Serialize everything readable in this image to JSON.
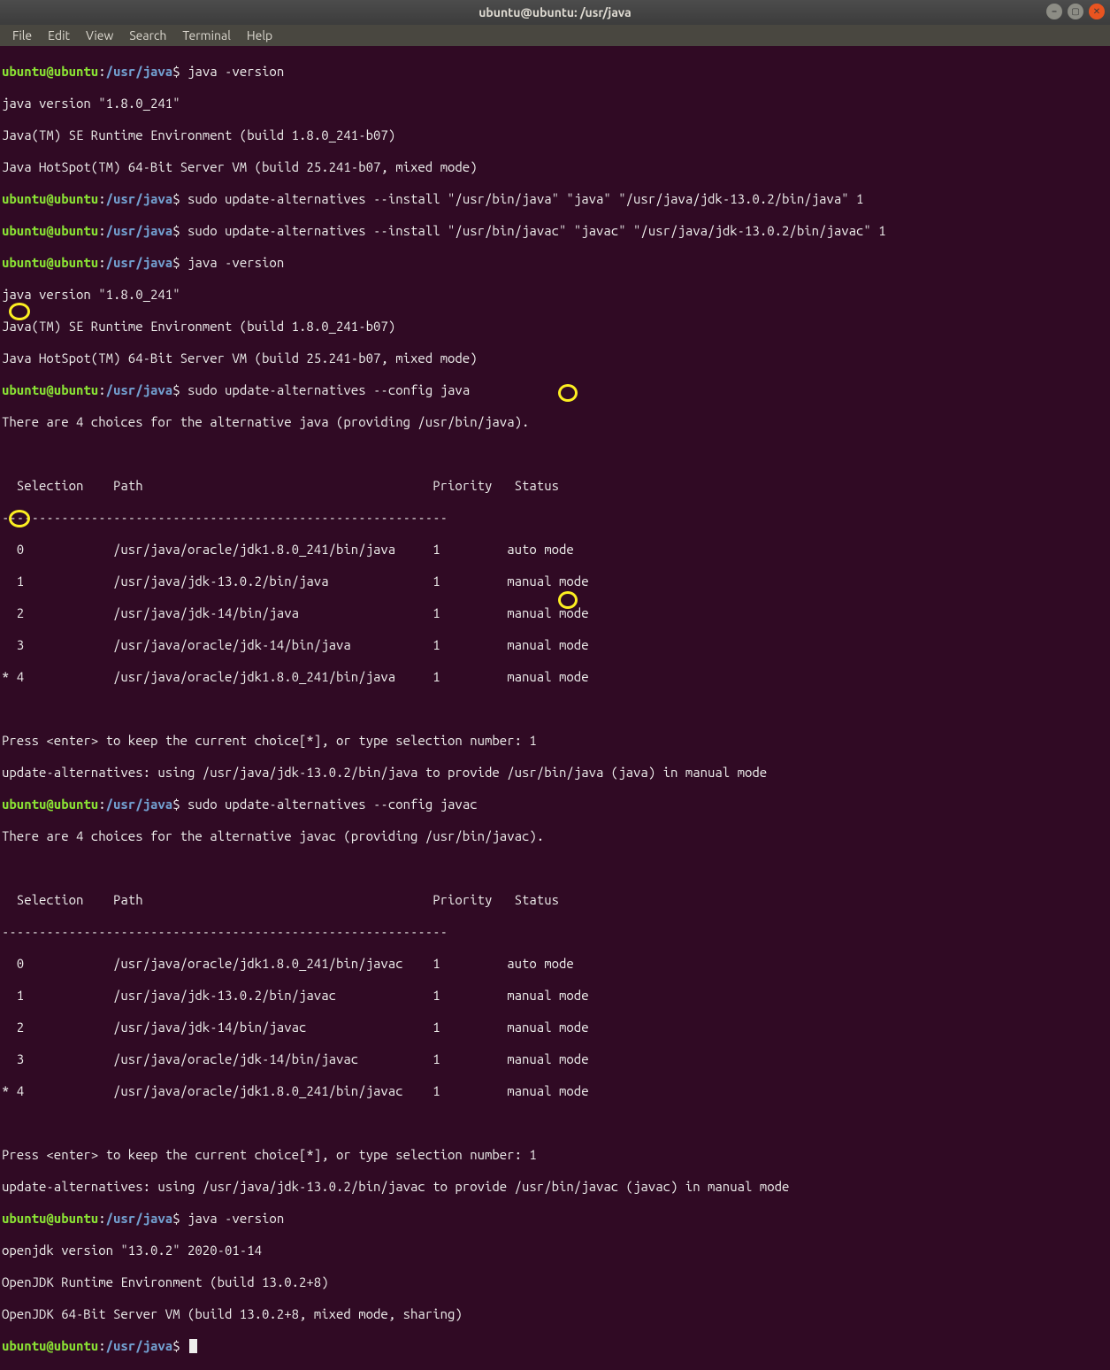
{
  "window": {
    "title": "ubuntu@ubuntu: /usr/java"
  },
  "menu": {
    "file": "File",
    "edit": "Edit",
    "view": "View",
    "search": "Search",
    "terminal": "Terminal",
    "help": "Help"
  },
  "prompt": {
    "userhost": "ubuntu@ubuntu",
    "colon": ":",
    "path": "/usr/java",
    "dollar": "$ "
  },
  "cmd": {
    "jv": "java -version",
    "inst_java": "sudo update-alternatives --install \"/usr/bin/java\" \"java\" \"/usr/java/jdk-13.0.2/bin/java\" 1",
    "inst_javac": "sudo update-alternatives --install \"/usr/bin/javac\" \"javac\" \"/usr/java/jdk-13.0.2/bin/javac\" 1",
    "cfg_java": "sudo update-alternatives --config java",
    "cfg_javac": "sudo update-alternatives --config javac"
  },
  "out": {
    "jv1_l1": "java version \"1.8.0_241\"",
    "jv1_l2": "Java(TM) SE Runtime Environment (build 1.8.0_241-b07)",
    "jv1_l3": "Java HotSpot(TM) 64-Bit Server VM (build 25.241-b07, mixed mode)",
    "choices_java": "There are 4 choices for the alternative java (providing /usr/bin/java).",
    "choices_javac": "There are 4 choices for the alternative javac (providing /usr/bin/javac).",
    "header": "  Selection    Path                                       Priority   Status",
    "rule": "------------------------------------------------------------",
    "java_rows": [
      "  0            /usr/java/oracle/jdk1.8.0_241/bin/java     1         auto mode",
      "  1            /usr/java/jdk-13.0.2/bin/java              1         manual mode",
      "  2            /usr/java/jdk-14/bin/java                  1         manual mode",
      "  3            /usr/java/oracle/jdk-14/bin/java           1         manual mode",
      "* 4            /usr/java/oracle/jdk1.8.0_241/bin/java     1         manual mode"
    ],
    "javac_rows": [
      "  0            /usr/java/oracle/jdk1.8.0_241/bin/javac    1         auto mode",
      "  1            /usr/java/jdk-13.0.2/bin/javac             1         manual mode",
      "  2            /usr/java/jdk-14/bin/javac                 1         manual mode",
      "  3            /usr/java/oracle/jdk-14/bin/javac          1         manual mode",
      "* 4            /usr/java/oracle/jdk1.8.0_241/bin/javac    1         manual mode"
    ],
    "press_prompt": "Press <enter> to keep the current choice[*], or type selection number: ",
    "sel": "1",
    "using_java": "update-alternatives: using /usr/java/jdk-13.0.2/bin/java to provide /usr/bin/java (java) in manual mode",
    "using_javac": "update-alternatives: using /usr/java/jdk-13.0.2/bin/javac to provide /usr/bin/javac (javac) in manual mode",
    "jv2_l1": "openjdk version \"13.0.2\" 2020-01-14",
    "jv2_l2": "OpenJDK Runtime Environment (build 13.0.2+8)",
    "jv2_l3": "OpenJDK 64-Bit Server VM (build 13.0.2+8, mixed mode, sharing)"
  },
  "blank": " "
}
